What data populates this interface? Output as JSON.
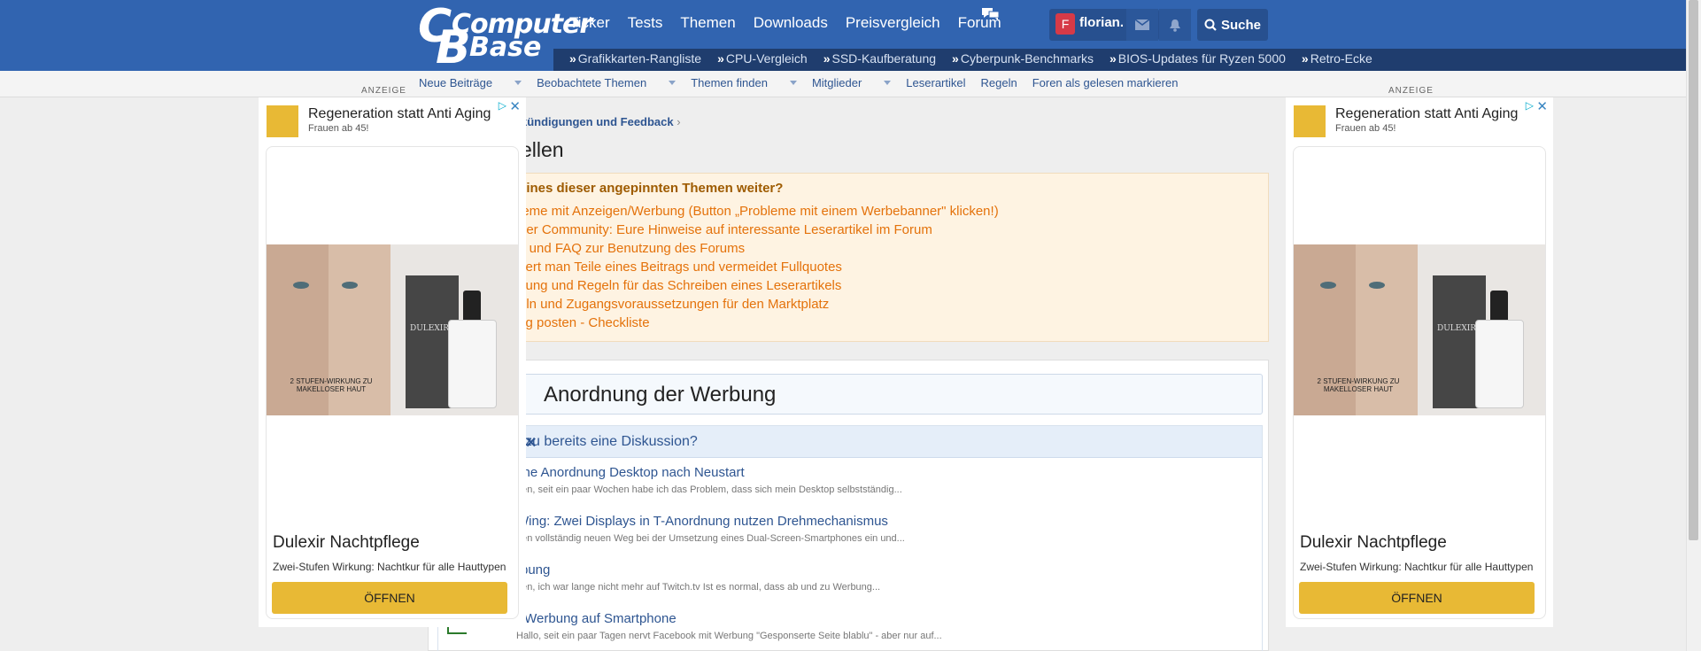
{
  "header": {
    "logo_line1": "Computer",
    "logo_line2": "Base",
    "nav": [
      "Ticker",
      "Tests",
      "Themen",
      "Downloads",
      "Preisvergleich",
      "Forum"
    ],
    "user_initial": "F",
    "username": "florian.",
    "search_label": "Suche",
    "quicklinks": [
      "Grafikkarten-Rangliste",
      "CPU-Vergleich",
      "SSD-Kaufberatung",
      "Cyberpunk-Benchmarks",
      "BIOS-Updates für Ryzen 5000",
      "Retro-Ecke"
    ]
  },
  "subnav": [
    "Neue Beiträge",
    "Beobachtete Themen",
    "Themen finden",
    "Mitglieder",
    "Leserartikel",
    "Regeln",
    "Foren als gelesen markieren"
  ],
  "ad_label": "ANZEIGE",
  "ad": {
    "headline": "Regeneration statt Anti Aging",
    "sub": "Frauen ab 45!",
    "brand": "DULEXIR",
    "slogan": "2 STUFEN-WIRKUNG ZU MAKELLOSER HAUT",
    "product": "Dulexir Nachtpflege",
    "description": "Zwei-Stufen Wirkung: Nachtkur für alle Hauttypen",
    "cta": "ÖFFNEN"
  },
  "breadcrumb": "kündigungen und Feedback",
  "page_title": "ellen",
  "pinned": {
    "heading": "eines dieser angepinnten Themen weiter?",
    "items": [
      "leme mit Anzeigen/Werbung (Button „Probleme mit einem Werbebanner\" klicken!)",
      "der Community: Eure Hinweise auf interessante Leserartikel im Forum",
      "s und FAQ zur Benutzung des Forums",
      "tiert man Teile eines Beitrags und vermeidet Fullquotes",
      "itung und Regeln für das Schreiben eines Leserartikels",
      "eln und Zugangsvoraussetzungen für den Marktplatz",
      "tig posten - Checkliste"
    ]
  },
  "editor_title": "Anordnung der Werbung",
  "similar": {
    "heading": "zu bereits eine Diskussion?",
    "items": [
      {
        "title": "che Anordnung Desktop nach Neustart",
        "snippet": "nen, seit ein paar Wochen habe ich das Problem, dass sich mein Desktop selbstständig..."
      },
      {
        "title": "Wing: Zwei Displays in T-Anordnung nutzen Drehmechanismus",
        "snippet": "nen vollständig neuen Weg bei der Umsetzung eines Dual-Screen-Smartphones ein und..."
      },
      {
        "title": "rbung",
        "snippet": "nen, ich war lange nicht mehr auf Twitch.tv Ist es normal, dass ab und zu Werbung..."
      },
      {
        "title": "- Werbung auf Smartphone",
        "snippet": "Hallo, seit ein paar Tagen nervt Facebook mit Werbung \"Gesponserte Seite blablu\" - aber nur auf..."
      }
    ]
  }
}
